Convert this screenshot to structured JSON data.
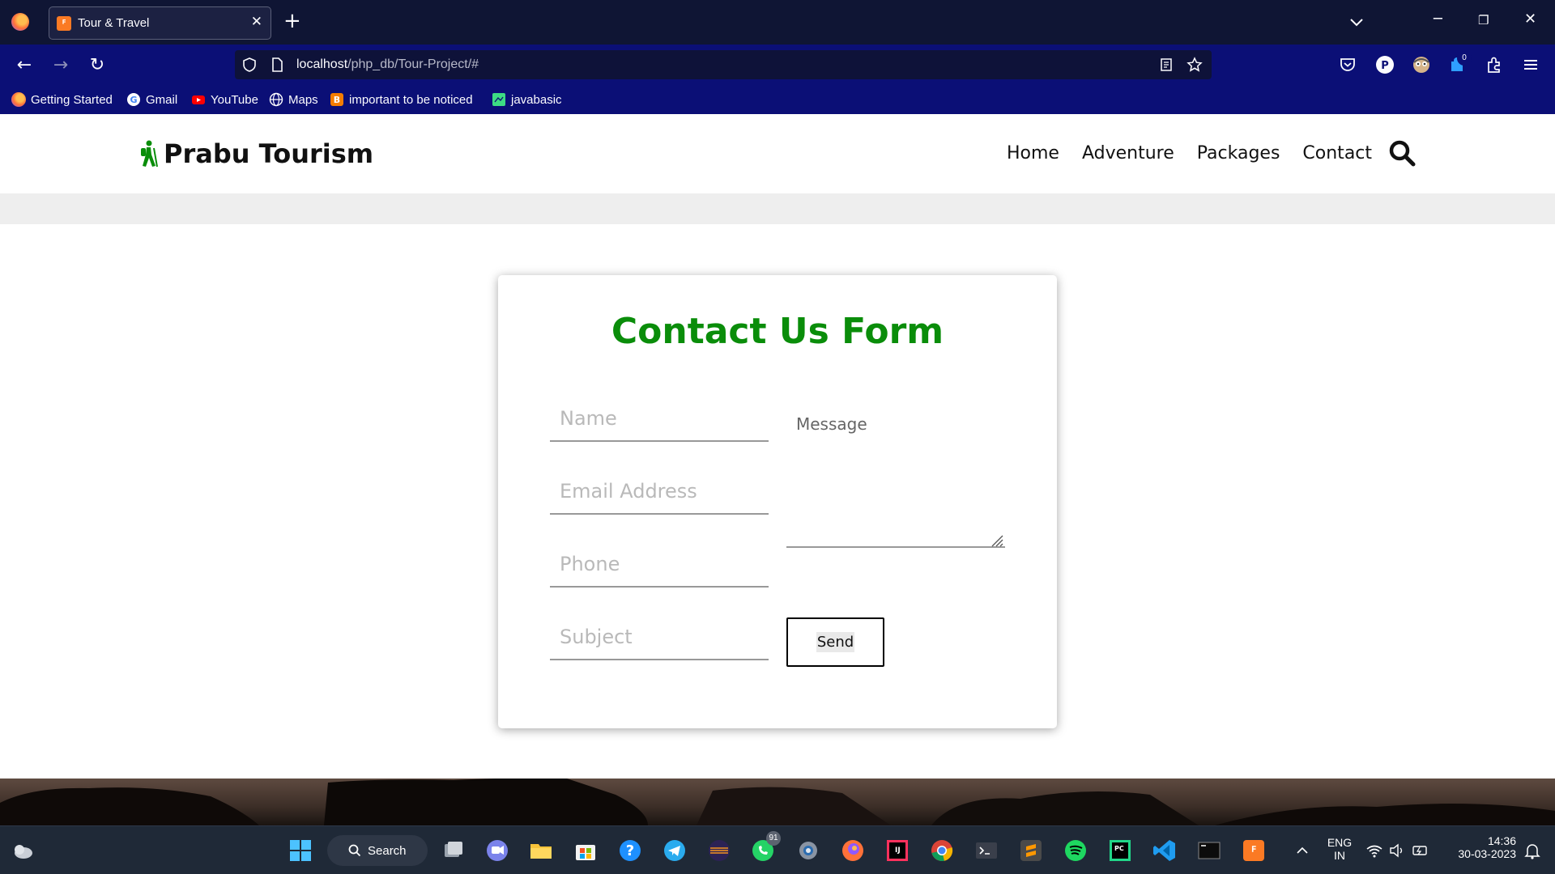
{
  "browser": {
    "tab_title": "Tour & Travel",
    "tab_favicon_letter": "ꟳ",
    "url_host": "localhost",
    "url_path": "/php_db/Tour-Project/#",
    "extension_badge": "0",
    "bookmarks": [
      {
        "label": "Getting Started",
        "icon": "firefox-icon",
        "color": "#ff7139"
      },
      {
        "label": "Gmail",
        "icon": "google-icon",
        "color": "#ffffff"
      },
      {
        "label": "YouTube",
        "icon": "youtube-icon",
        "color": "#ff0000"
      },
      {
        "label": "Maps",
        "icon": "globe-icon",
        "color": "#ffffff"
      },
      {
        "label": "important to be noticed",
        "icon": "blogger-icon",
        "color": "#f57d00"
      },
      {
        "label": "javabasic",
        "icon": "bookmark-page-icon",
        "color": "#3ddc84"
      }
    ]
  },
  "site": {
    "brand": "Prabu Tourism",
    "nav": [
      "Home",
      "Adventure",
      "Packages",
      "Contact"
    ],
    "accent_color": "#0a8d0a"
  },
  "form": {
    "title": "Contact Us Form",
    "name_placeholder": "Name",
    "email_placeholder": "Email Address",
    "phone_placeholder": "Phone",
    "subject_placeholder": "Subject",
    "message_placeholder": "Message",
    "send_label": "Send"
  },
  "taskbar": {
    "search_label": "Search",
    "whatsapp_badge": "91",
    "lang_top": "ENG",
    "lang_bottom": "IN",
    "time": "14:36",
    "date": "30-03-2023"
  }
}
